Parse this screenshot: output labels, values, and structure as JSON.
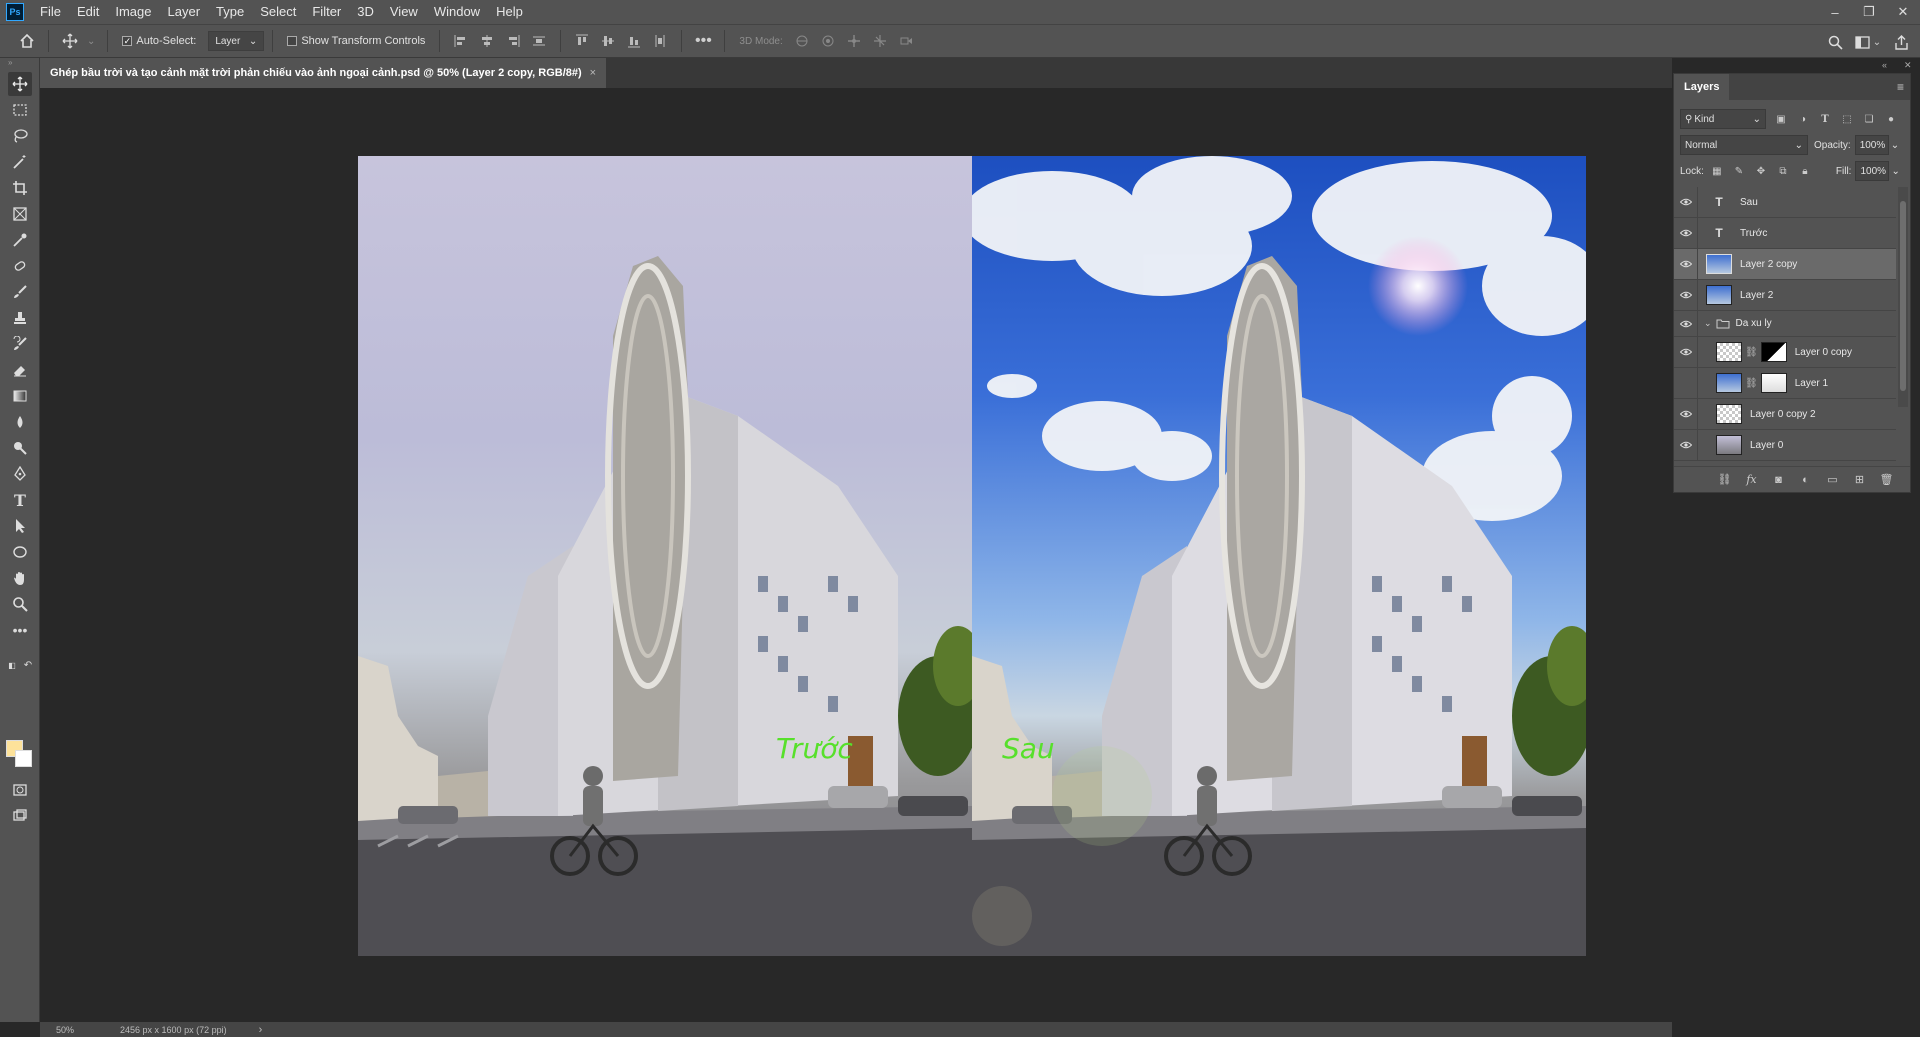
{
  "app": {
    "logo": "Ps",
    "menu": [
      "File",
      "Edit",
      "Image",
      "Layer",
      "Type",
      "Select",
      "Filter",
      "3D",
      "View",
      "Window",
      "Help"
    ]
  },
  "window_controls": [
    "–",
    "❐",
    "✕"
  ],
  "options_bar": {
    "auto_select_label": "Auto-Select:",
    "auto_select_target": "Layer",
    "show_transform_label": "Show Transform Controls",
    "mode_3d_label": "3D Mode:"
  },
  "document_tab": {
    "title": "Ghép bầu trời và tạo cảnh mặt trời phản chiếu vào ảnh ngoại cảnh.psd @ 50% (Layer 2 copy, RGB/8#)",
    "close": "×"
  },
  "canvas": {
    "left_label": "Trước",
    "right_label": "Sau"
  },
  "status_bar": {
    "zoom": "50%",
    "doc_info": "2456 px x 1600 px (72 ppi)",
    "arrow": "›"
  },
  "colors": {
    "foreground": "#fde29a",
    "background": "#ffffff",
    "label_green": "#57e02b"
  },
  "layers_panel": {
    "title": "Layers",
    "filter_kind": "Kind",
    "blend_mode": "Normal",
    "opacity_label": "Opacity:",
    "opacity_value": "100%",
    "lock_label": "Lock:",
    "fill_label": "Fill:",
    "fill_value": "100%",
    "layers": [
      {
        "name": "Sau",
        "type": "text",
        "visible": true
      },
      {
        "name": "Trước",
        "type": "text",
        "visible": true
      },
      {
        "name": "Layer 2 copy",
        "type": "image",
        "visible": true,
        "selected": true
      },
      {
        "name": "Layer 2",
        "type": "image",
        "visible": true
      },
      {
        "name": "Da xu ly",
        "type": "group",
        "visible": true
      },
      {
        "name": "Layer 0 copy",
        "type": "masked",
        "visible": true
      },
      {
        "name": "Layer 1",
        "type": "masked",
        "visible": false
      },
      {
        "name": "Layer 0 copy 2",
        "type": "image",
        "visible": true
      },
      {
        "name": "Layer 0",
        "type": "image",
        "visible": true
      }
    ]
  }
}
